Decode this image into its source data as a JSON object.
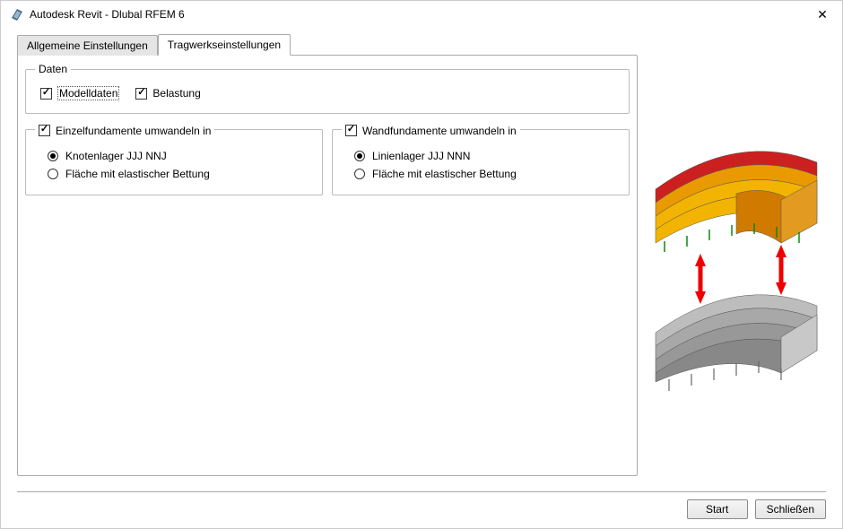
{
  "window": {
    "title": "Autodesk Revit - Dlubal RFEM 6"
  },
  "tabs": [
    {
      "label": "Allgemeine Einstellungen",
      "active": false
    },
    {
      "label": "Tragwerkseinstellungen",
      "active": true
    }
  ],
  "groups": {
    "data": {
      "legend": "Daten",
      "modelldaten": {
        "label": "Modelldaten",
        "checked": true,
        "focused": true
      },
      "belastung": {
        "label": "Belastung",
        "checked": true
      }
    },
    "einzel": {
      "legend": "Einzelfundamente umwandeln in",
      "checked": true,
      "options": {
        "knoten": {
          "label": "Knotenlager JJJ NNJ",
          "selected": true
        },
        "flaeche": {
          "label": "Fläche mit elastischer Bettung",
          "selected": false
        }
      }
    },
    "wand": {
      "legend": "Wandfundamente umwandeln in",
      "checked": true,
      "options": {
        "linien": {
          "label": "Linienlager JJJ NNN",
          "selected": true
        },
        "flaeche": {
          "label": "Fläche mit elastischer Bettung",
          "selected": false
        }
      }
    }
  },
  "buttons": {
    "start": "Start",
    "close": "Schließen"
  }
}
